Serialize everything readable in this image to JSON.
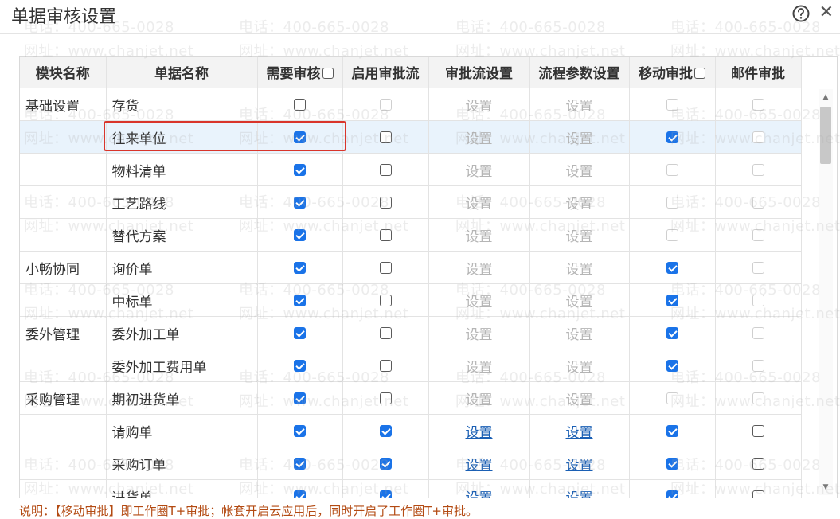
{
  "title": "单据审核设置",
  "help_icon": "help-circle-icon",
  "close_icon": "close-icon",
  "columns": {
    "module": "模块名称",
    "doc": "单据名称",
    "need_review": "需要审核",
    "enable_flow": "启用审批流",
    "flow_settings": "审批流设置",
    "param_settings": "流程参数设置",
    "mobile": "移动审批",
    "mail": "邮件审批"
  },
  "setting_label": "设置",
  "rows": [
    {
      "module": "基础设置",
      "doc": "存货",
      "need": "off",
      "flow": "dis",
      "link_enabled": false,
      "mobile": "dis",
      "mail": "dis"
    },
    {
      "module": "",
      "doc": "往来单位",
      "need": "on",
      "flow": "off",
      "link_enabled": false,
      "mobile": "on",
      "mail": "dis",
      "selected": true
    },
    {
      "module": "",
      "doc": "物料清单",
      "need": "on",
      "flow": "off",
      "link_enabled": false,
      "mobile": "dis",
      "mail": "dis"
    },
    {
      "module": "",
      "doc": "工艺路线",
      "need": "on",
      "flow": "off",
      "link_enabled": false,
      "mobile": "dis",
      "mail": "dis"
    },
    {
      "module": "",
      "doc": "替代方案",
      "need": "on",
      "flow": "off",
      "link_enabled": false,
      "mobile": "dis",
      "mail": "dis"
    },
    {
      "module": "小畅协同",
      "doc": "询价单",
      "need": "on",
      "flow": "off",
      "link_enabled": false,
      "mobile": "on",
      "mail": "dis"
    },
    {
      "module": "",
      "doc": "中标单",
      "need": "on",
      "flow": "off",
      "link_enabled": false,
      "mobile": "on",
      "mail": "dis"
    },
    {
      "module": "委外管理",
      "doc": "委外加工单",
      "need": "on",
      "flow": "off",
      "link_enabled": false,
      "mobile": "on",
      "mail": "dis"
    },
    {
      "module": "",
      "doc": "委外加工费用单",
      "need": "on",
      "flow": "off",
      "link_enabled": false,
      "mobile": "on",
      "mail": "dis"
    },
    {
      "module": "采购管理",
      "doc": "期初进货单",
      "need": "on",
      "flow": "off",
      "link_enabled": false,
      "mobile": "dis",
      "mail": "dis"
    },
    {
      "module": "",
      "doc": "请购单",
      "need": "on",
      "flow": "on",
      "link_enabled": true,
      "mobile": "on",
      "mail": "off"
    },
    {
      "module": "",
      "doc": "采购订单",
      "need": "on",
      "flow": "on",
      "link_enabled": true,
      "mobile": "on",
      "mail": "off"
    },
    {
      "module": "",
      "doc": "进货单",
      "need": "on",
      "flow": "on",
      "link_enabled": true,
      "mobile": "on",
      "mail": "off"
    }
  ],
  "watermark_phone": "电话：400-665-0028",
  "watermark_url": "网址：www.chanjet.net",
  "note": "说明：【移动审批】即工作圈T+审批；帐套开启云应用后，同时开启了工作圈T+审批。"
}
